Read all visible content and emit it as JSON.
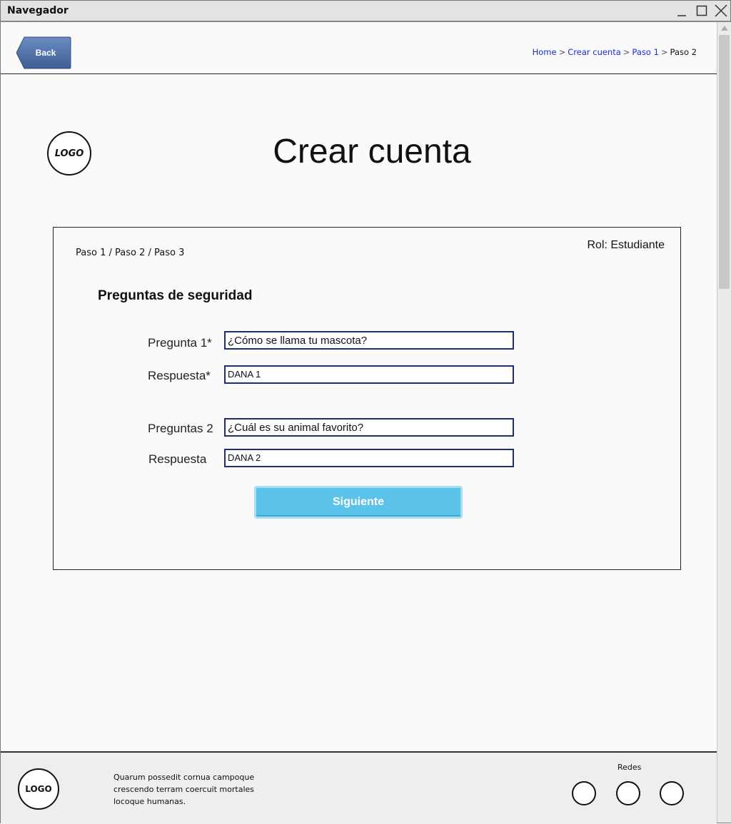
{
  "window": {
    "title": "Navegador"
  },
  "header": {
    "back_label": "Back",
    "breadcrumb": {
      "items": [
        "Home",
        "Crear cuenta",
        "Paso 1"
      ],
      "current": "Paso 2",
      "separator": ">"
    }
  },
  "logo_text": "LOGO",
  "page_title": "Crear cuenta",
  "form": {
    "steps": "Paso 1 / Paso 2 / Paso 3",
    "role": "Rol: Estudiante",
    "section_title": "Preguntas de seguridad",
    "question1_label": "Pregunta 1*",
    "question1_value": "¿Cómo se llama tu mascota?",
    "answer1_label": "Respuesta*",
    "answer1_value": "DANA 1",
    "question2_label": "Preguntas 2",
    "question2_value": "¿Cuál es su animal favorito?",
    "answer2_label": "Respuesta",
    "answer2_value": "DANA 2",
    "submit_label": "Siguiente"
  },
  "footer": {
    "logo_text": "LOGO",
    "text": "Quarum possedit cornua campoque crescendo terram coercuit mortales locoque humanas.",
    "social_title": "Redes",
    "social_count": 3
  },
  "colors": {
    "back_button": "#4d6fa6",
    "breadcrumb_link": "#1a2bd6",
    "input_border": "#1f2f6b",
    "submit_button": "#5bc3ea"
  }
}
